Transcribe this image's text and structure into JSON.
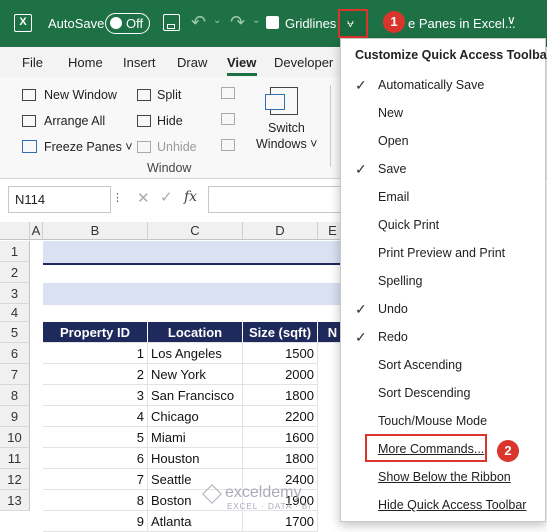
{
  "titlebar": {
    "autosave_label": "AutoSave",
    "toggle_state": "Off",
    "gridlines_label": "Gridlines",
    "doc_title": "e Panes in Excel...",
    "qa_dropdown_icon": "⩝",
    "badge1": "1",
    "badge2": "2"
  },
  "tabs": [
    "File",
    "Home",
    "Insert",
    "Draw",
    "View",
    "Developer"
  ],
  "ribbon": {
    "new_window": "New Window",
    "arrange_all": "Arrange All",
    "freeze_panes": "Freeze Panes ˅",
    "split": "Split",
    "hide": "Hide",
    "unhide": "Unhide",
    "switch_windows_1": "Switch",
    "switch_windows_2": "Windows ˅",
    "group_label": "Window"
  },
  "formula_bar": {
    "name_box": "N114",
    "fx": "fx"
  },
  "columns": [
    "A",
    "B",
    "C",
    "D",
    "E"
  ],
  "rows": [
    "1",
    "2",
    "3",
    "4",
    "5",
    "6",
    "7",
    "8",
    "9",
    "10",
    "11",
    "12",
    "13"
  ],
  "table": {
    "headers": [
      "Property ID",
      "Location",
      "Size (sqft)",
      "N"
    ],
    "rows": [
      {
        "id": "1",
        "location": "Los Angeles",
        "size": "1500"
      },
      {
        "id": "2",
        "location": "New York",
        "size": "2000"
      },
      {
        "id": "3",
        "location": "San Francisco",
        "size": "1800"
      },
      {
        "id": "4",
        "location": "Chicago",
        "size": "2200"
      },
      {
        "id": "5",
        "location": "Miami",
        "size": "1600"
      },
      {
        "id": "6",
        "location": "Houston",
        "size": "1800"
      },
      {
        "id": "7",
        "location": "Seattle",
        "size": "2400"
      },
      {
        "id": "8",
        "location": "Boston",
        "size": "1900"
      },
      {
        "id": "9",
        "location": "Atlanta",
        "size": "1700"
      }
    ]
  },
  "menu": {
    "title": "Customize Quick Access Toolbar",
    "items": [
      {
        "label": "Automatically Save",
        "checked": "✓"
      },
      {
        "label": "New",
        "checked": ""
      },
      {
        "label": "Open",
        "checked": ""
      },
      {
        "label": "Save",
        "checked": "✓"
      },
      {
        "label": "Email",
        "checked": ""
      },
      {
        "label": "Quick Print",
        "checked": ""
      },
      {
        "label": "Print Preview and Print",
        "checked": ""
      },
      {
        "label": "Spelling",
        "checked": ""
      },
      {
        "label": "Undo",
        "checked": "✓"
      },
      {
        "label": "Redo",
        "checked": "✓"
      },
      {
        "label": "Sort Ascending",
        "checked": ""
      },
      {
        "label": "Sort Descending",
        "checked": ""
      },
      {
        "label": "Touch/Mouse Mode",
        "checked": ""
      },
      {
        "label": "More Commands...",
        "checked": ""
      },
      {
        "label": "Show Below the Ribbon",
        "checked": ""
      },
      {
        "label": "Hide Quick Access Toolbar",
        "checked": ""
      }
    ]
  },
  "watermark": {
    "brand": "exceldemy",
    "tagline": "EXCEL · DATA · BI"
  },
  "colors": {
    "excel_green": "#1e7145",
    "header_navy": "#1f2a5c",
    "highlight_red": "#d9352c",
    "band_blue": "#d9e1f2"
  }
}
